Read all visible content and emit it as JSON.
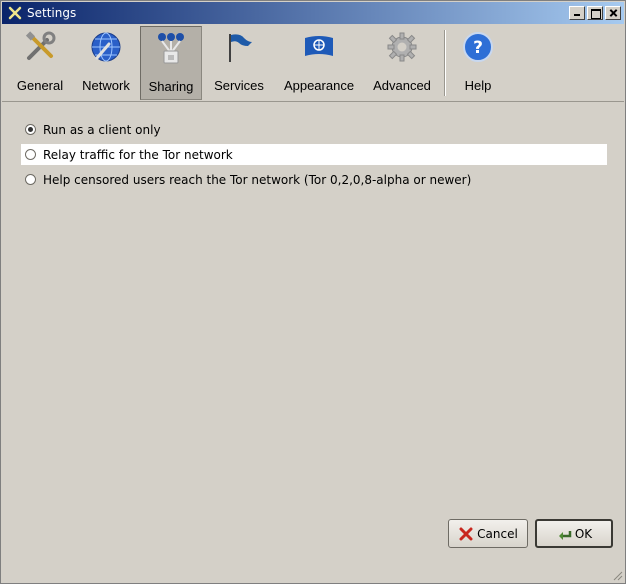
{
  "window": {
    "title": "Settings"
  },
  "toolbar": {
    "items": [
      {
        "label": "General",
        "icon": "tools-icon"
      },
      {
        "label": "Network",
        "icon": "globe-icon"
      },
      {
        "label": "Sharing",
        "icon": "sharing-icon",
        "active": true
      },
      {
        "label": "Services",
        "icon": "flag-icon"
      },
      {
        "label": "Appearance",
        "icon": "appearance-flag-icon"
      },
      {
        "label": "Advanced",
        "icon": "gear-icon"
      },
      {
        "label": "Help",
        "icon": "help-icon"
      }
    ]
  },
  "sharing": {
    "options": [
      {
        "label": "Run as a client only",
        "selected": true
      },
      {
        "label": "Relay traffic for the Tor network",
        "selected": false
      },
      {
        "label": "Help censored users reach the Tor network (Tor 0,2,0,8-alpha or newer)",
        "selected": false
      }
    ]
  },
  "buttons": {
    "cancel_label": "Cancel",
    "ok_label": "OK"
  },
  "colors": {
    "window_bg": "#d4d0c8",
    "titlebar_start": "#0a246a",
    "titlebar_end": "#a6caf0",
    "active_tab_bg": "#b4b0a8"
  }
}
